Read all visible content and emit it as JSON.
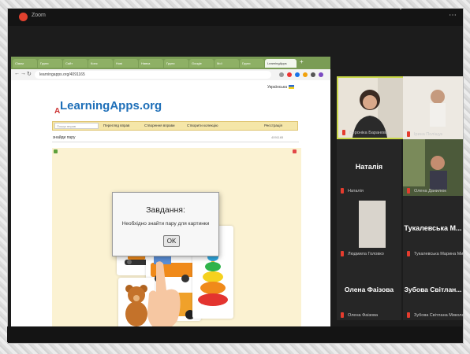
{
  "meeting": {
    "label": "Zoom"
  },
  "browser": {
    "tabs": [
      "Classr",
      "Групи",
      "Сайт",
      "Конс",
      "Нові",
      "Навча",
      "Групи",
      "Google",
      "Мої",
      "Групи",
      "Instr"
    ],
    "active_tab": "LearningApps",
    "url": "learningapps.org/4091165",
    "language": "Українська"
  },
  "site": {
    "logo": "LearningApps.org",
    "search_placeholder": "Пошук вправ",
    "menu": [
      "Перегляд вправ",
      "Створення вправи",
      "Створити колекцію",
      "Реєстрація"
    ],
    "app_title": "знайди пару",
    "app_id": "4091165"
  },
  "dialog": {
    "title": "Завдання:",
    "text": "Необхідно знайти пару для картинки",
    "ok": "OK"
  },
  "participants": [
    {
      "name": "Вероніка Баранова",
      "kind": "video"
    },
    {
      "name": "Ірина Поліщук",
      "kind": "video"
    },
    {
      "name": "Наталія",
      "display": "Наталія",
      "kind": "name"
    },
    {
      "name": "Олена Данилюк",
      "kind": "video"
    },
    {
      "name": "Людмила Головко",
      "kind": "video"
    },
    {
      "name": "Тукалевська Марина Ми",
      "display": "Тукалевська М...",
      "kind": "name"
    },
    {
      "name": "Олена Фаізова",
      "display": "Олена Фаізова",
      "kind": "name"
    },
    {
      "name": "Зубова Світлана Микола",
      "display": "Зубова Світлан...",
      "kind": "name"
    }
  ],
  "colors": {
    "accent": "#7a9c55",
    "speaker_border": "#c9d84a",
    "game_bg": "#fbf2d2",
    "mic_muted": "#e53c2e"
  }
}
